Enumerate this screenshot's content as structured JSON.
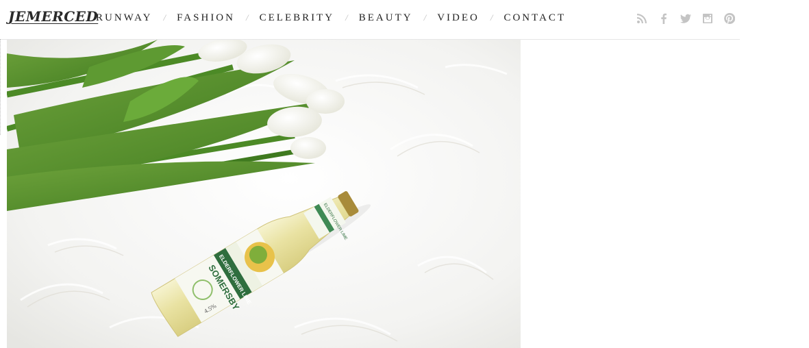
{
  "site": {
    "logo_text": "JEMERCED"
  },
  "nav": {
    "items": [
      {
        "label": "RUNWAY"
      },
      {
        "label": "FASHION"
      },
      {
        "label": "CELEBRITY"
      },
      {
        "label": "BEAUTY"
      },
      {
        "label": "VIDEO"
      },
      {
        "label": "CONTACT"
      }
    ],
    "separator": "/"
  },
  "social": {
    "icons": [
      "rss-icon",
      "facebook-icon",
      "twitter-icon",
      "instagram-icon",
      "pinterest-icon"
    ],
    "color": "#c4c4c4"
  },
  "hero": {
    "bottle_brand": "SOMERSBY",
    "bottle_flavor": "ELDERFLOWER LIME",
    "bottle_neck_text": "ELDERFLOWER LIME",
    "bottle_abv": "4.5%"
  }
}
